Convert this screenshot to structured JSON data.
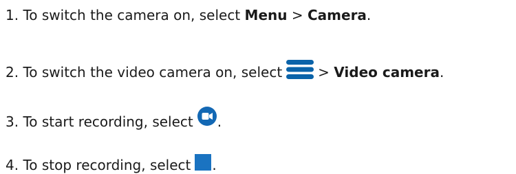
{
  "steps": [
    {
      "number": "1.",
      "text_before": "To switch the camera on, select",
      "bold_1": "Menu",
      "separator": ">",
      "bold_2": "Camera",
      "end": "."
    },
    {
      "number": "2.",
      "text_before": "To switch the video camera on, select",
      "icon": "menu-icon",
      "separator": ">",
      "bold": "Video camera",
      "end": "."
    },
    {
      "number": "3.",
      "text_before": "To start recording, select",
      "icon": "video-record-icon",
      "end": "."
    },
    {
      "number": "4.",
      "text_before": "To stop recording, select",
      "icon": "stop-icon",
      "end": "."
    }
  ],
  "colors": {
    "text": "#1a1a1a",
    "icon_menu": "#0a63a9",
    "icon_record": "#1368b4",
    "icon_stop": "#1a73c1"
  }
}
